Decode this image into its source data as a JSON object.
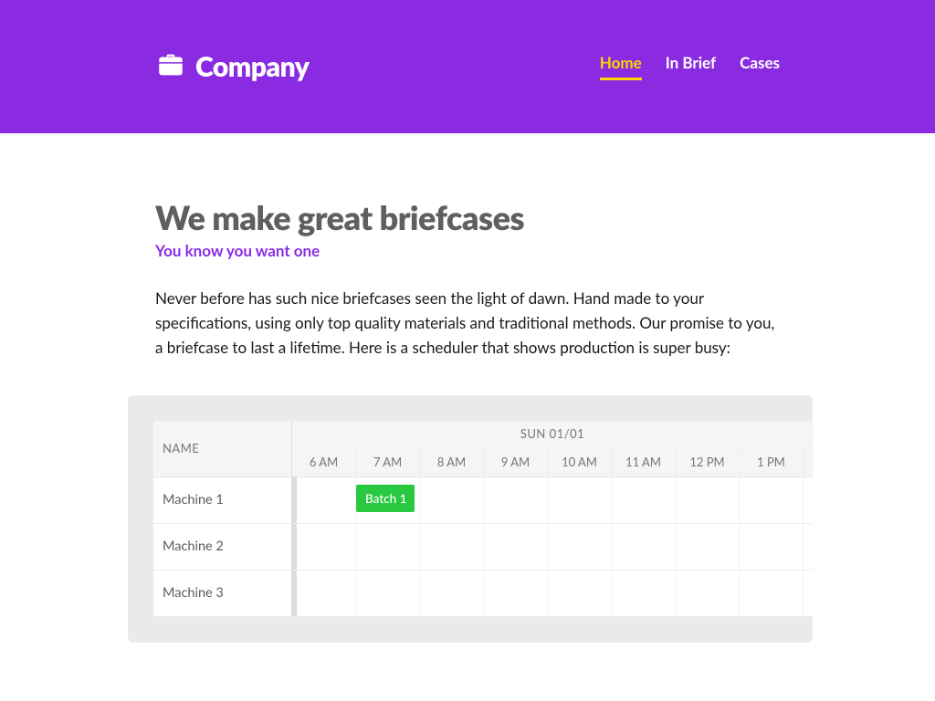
{
  "brand": {
    "name": "Company"
  },
  "nav": {
    "items": [
      {
        "label": "Home",
        "active": true
      },
      {
        "label": "In Brief",
        "active": false
      },
      {
        "label": "Cases",
        "active": false
      }
    ]
  },
  "hero": {
    "title": "We make great briefcases",
    "subtitle": "You know you want one",
    "body": "Never before has such nice briefcases seen the light of dawn. Hand made to your specifications, using only top quality materials and traditional methods. Our promise to you, a briefcase to last a lifetime. Here is a scheduler that shows production is super busy:"
  },
  "scheduler": {
    "name_column": "NAME",
    "day_header": "SUN 01/01",
    "hours": [
      "6 AM",
      "7 AM",
      "8 AM",
      "9 AM",
      "10 AM",
      "11 AM",
      "12 PM",
      "1 PM"
    ],
    "resources": [
      {
        "name": "Machine 1"
      },
      {
        "name": "Machine 2"
      },
      {
        "name": "Machine 3"
      }
    ],
    "events": [
      {
        "resource_index": 0,
        "label": "Batch 1",
        "start_hour_index": 1,
        "color": "#28c840"
      }
    ]
  }
}
